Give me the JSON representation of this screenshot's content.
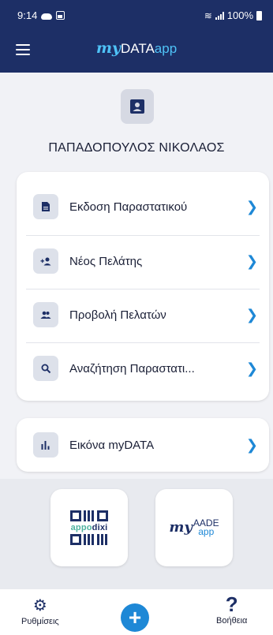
{
  "status_bar": {
    "time": "9:14",
    "battery": "100%"
  },
  "header": {
    "logo_my": "my",
    "logo_data": "DATA",
    "logo_app": "app"
  },
  "profile": {
    "name": "ΠΑΠΑΔΟΠΟΥΛΟΣ ΝΙΚΟΛΑΟΣ"
  },
  "menu": {
    "items": [
      {
        "label": "Εκδοση Παραστατικού",
        "icon": "document-icon"
      },
      {
        "label": "Νέος Πελάτης",
        "icon": "add-user-icon"
      },
      {
        "label": "Προβολή Πελατών",
        "icon": "users-icon"
      },
      {
        "label": "Αναζήτηση Παραστατι...",
        "icon": "search-icon"
      }
    ],
    "single": {
      "label": "Εικόνα myDATA",
      "icon": "bar-chart-icon"
    }
  },
  "tiles": {
    "appodixi": {
      "brand_a": "appo",
      "brand_b": "dixi"
    },
    "myaade": {
      "my": "my",
      "name": "AADE",
      "sub": "app"
    }
  },
  "bottom_nav": {
    "settings_label": "Ρυθμίσεις",
    "add_label": "+",
    "help_label": "Βοήθεια"
  },
  "colors": {
    "header_bg": "#1d2f66",
    "accent": "#1e88d6",
    "icon_bg": "#dde1ea"
  }
}
